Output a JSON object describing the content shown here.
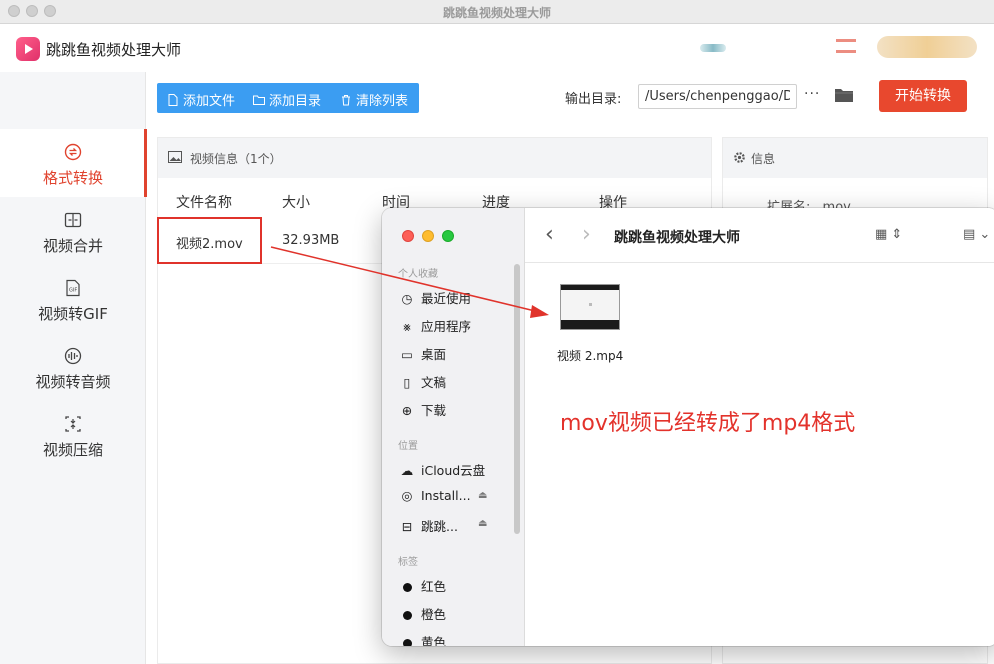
{
  "window": {
    "title": "跳跳鱼视频处理大师"
  },
  "app": {
    "name": "跳跳鱼视频处理大师"
  },
  "sidebar": {
    "items": [
      {
        "label": "格式转换",
        "icon": "swap-icon",
        "active": true
      },
      {
        "label": "视频合并",
        "icon": "merge-icon",
        "active": false
      },
      {
        "label": "视频转GIF",
        "icon": "gif-icon",
        "active": false
      },
      {
        "label": "视频转音频",
        "icon": "audio-icon",
        "active": false
      },
      {
        "label": "视频压缩",
        "icon": "compress-icon",
        "active": false
      }
    ]
  },
  "toolbar": {
    "add_file": "添加文件",
    "add_dir": "添加目录",
    "clear_list": "清除列表",
    "output_label": "输出目录:",
    "output_path": "/Users/chenpenggao/D",
    "more": "···",
    "start": "开始转换"
  },
  "video_panel": {
    "title": "视频信息（1个）",
    "columns": [
      "文件名称",
      "大小",
      "时间",
      "进度",
      "操作"
    ],
    "rows": [
      {
        "name": "视频2.mov",
        "size": "32.93MB"
      }
    ]
  },
  "info_panel": {
    "title": "信息",
    "ext_label": "扩展名:",
    "ext_value": "mov"
  },
  "finder": {
    "title": "跳跳鱼视频处理大师",
    "sections": {
      "favorites": "个人收藏",
      "locations": "位置",
      "tags": "标签"
    },
    "favorites": [
      "最近使用",
      "应用程序",
      "桌面",
      "文稿",
      "下载"
    ],
    "locations": [
      "iCloud云盘",
      "Install...",
      "跳跳..."
    ],
    "tags": [
      "红色",
      "橙色",
      "黄色"
    ],
    "file": {
      "name": "视频 2.mp4"
    }
  },
  "annotation": {
    "text": "mov视频已经转成了mp4格式"
  },
  "colors": {
    "accent": "#e8482e",
    "toolbar_blue": "#3b9df2",
    "annotation_red": "#e3322b"
  }
}
